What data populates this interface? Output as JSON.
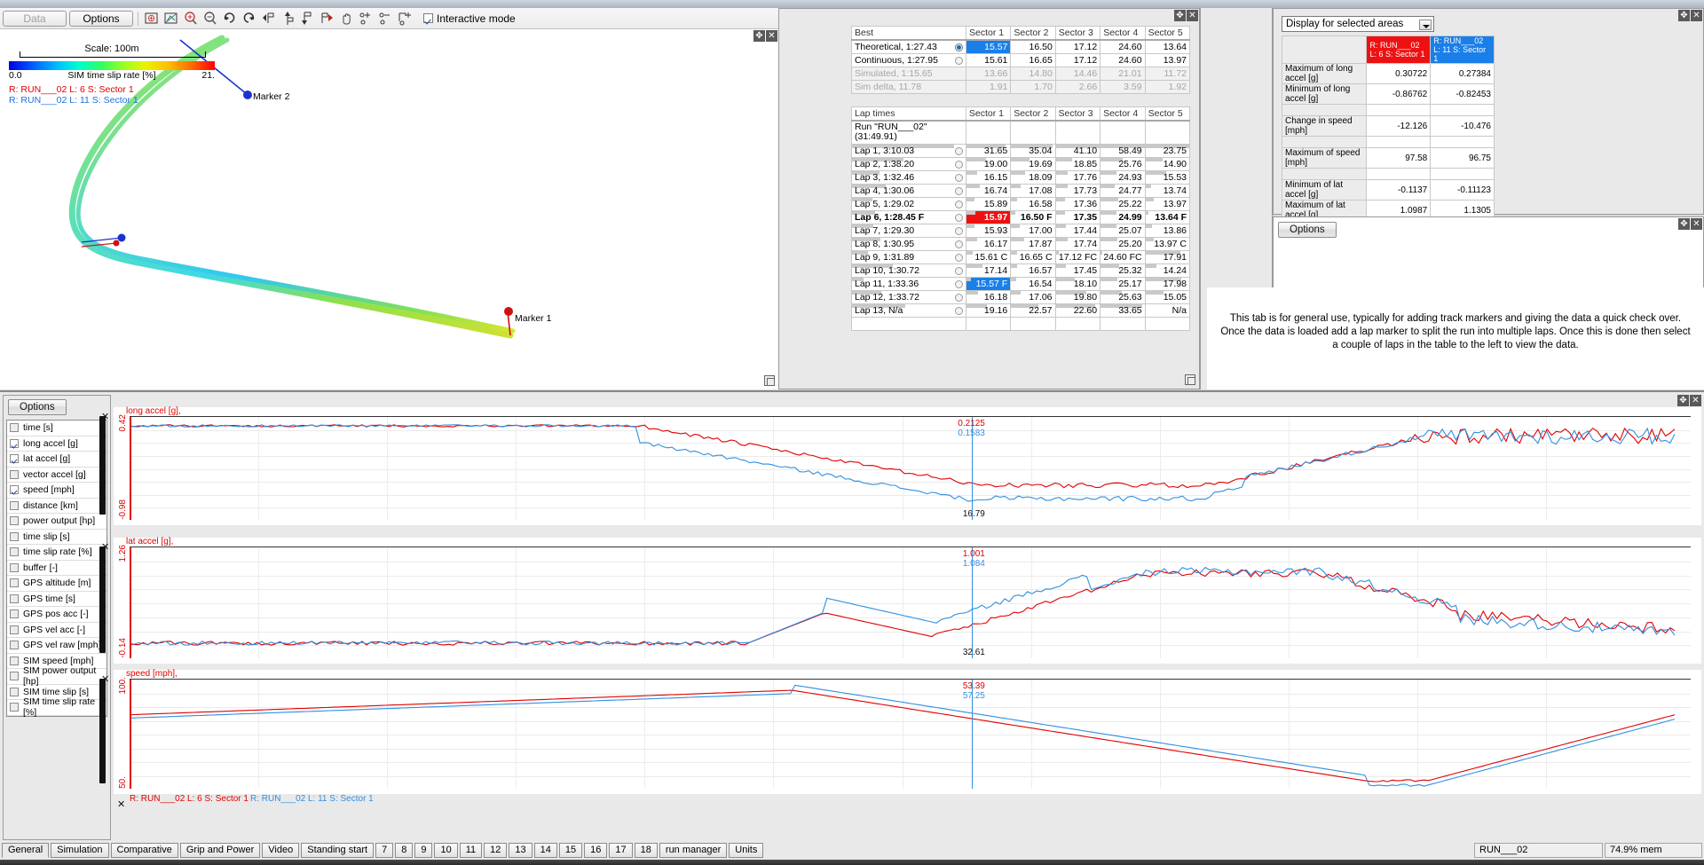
{
  "toolbar": {
    "data_label": "Data",
    "options_label": "Options",
    "interactive_label": "Interactive mode",
    "interactive_checked": true,
    "icons": [
      "zoom-box-icon",
      "fit-view-icon",
      "zoom-in-icon",
      "zoom-out-icon",
      "rotate-cw-icon",
      "rotate-ccw-icon",
      "prev-marker-icon",
      "add-marker-icon",
      "marker-down-icon",
      "next-marker-icon",
      "pan-hand-icon",
      "add-node-icon",
      "remove-node-icon",
      "add-region-icon"
    ]
  },
  "map": {
    "scale_label": "Scale: 100m",
    "colorbar_min": "0.0",
    "colorbar_label": "SIM time slip rate [%]",
    "colorbar_max": "21.",
    "run_red": "R: RUN___02  L: 6  S: Sector 1",
    "run_blue": "R: RUN___02  L: 11  S: Sector 1",
    "marker1": "Marker 1",
    "marker2": "Marker 2"
  },
  "best": {
    "title": "Best",
    "columns": [
      "Sector 1",
      "Sector 2",
      "Sector 3",
      "Sector 4",
      "Sector 5"
    ],
    "rows": [
      {
        "label": "Theoretical,  1:27.43",
        "radio": "on",
        "dim": false,
        "values": [
          "15.57",
          "16.50",
          "17.12",
          "24.60",
          "13.64"
        ],
        "highlight": [
          0
        ]
      },
      {
        "label": "Continuous,  1:27.95",
        "radio": "off",
        "dim": false,
        "values": [
          "15.61",
          "16.65",
          "17.12",
          "24.60",
          "13.97"
        ],
        "highlight": []
      },
      {
        "label": "Simulated, 1:15.65",
        "radio": "none",
        "dim": true,
        "values": [
          "13.66",
          "14.80",
          "14.46",
          "21.01",
          "11.72"
        ],
        "highlight": []
      },
      {
        "label": "Sim delta, 11.78",
        "radio": "none",
        "dim": true,
        "values": [
          "1.91",
          "1.70",
          "2.66",
          "3.59",
          "1.92"
        ],
        "highlight": []
      }
    ]
  },
  "laps": {
    "title": "Lap times",
    "columns": [
      "Sector 1",
      "Sector 2",
      "Sector 3",
      "Sector 4",
      "Sector 5"
    ],
    "run_header": "Run \"RUN___02\"",
    "run_total": "(31:49.91)",
    "rows": [
      {
        "label": "Lap 1, 3:10.03",
        "bold": false,
        "values": [
          "31.65",
          "35.04",
          "41.10",
          "58.49",
          "23.75"
        ],
        "bars": [
          90,
          95,
          100,
          100,
          100
        ],
        "red": [],
        "blue": []
      },
      {
        "label": "Lap 2, 1:38.20",
        "bold": false,
        "values": [
          "19.00",
          "19.69",
          "18.85",
          "25.76",
          "14.90"
        ],
        "bars": [
          45,
          42,
          38,
          50,
          40
        ],
        "red": [],
        "blue": []
      },
      {
        "label": "Lap 3, 1:32.46",
        "bold": false,
        "values": [
          "16.15",
          "18.09",
          "17.76",
          "24.93",
          "15.53"
        ],
        "bars": [
          24,
          32,
          28,
          36,
          48
        ],
        "red": [],
        "blue": []
      },
      {
        "label": "Lap 4, 1:30.06",
        "bold": false,
        "values": [
          "16.74",
          "17.08",
          "17.73",
          "24.77",
          "13.74"
        ],
        "bars": [
          30,
          22,
          27,
          32,
          12
        ],
        "red": [],
        "blue": []
      },
      {
        "label": "Lap 5, 1:29.02",
        "bold": false,
        "values": [
          "15.89",
          "16.58",
          "17.36",
          "25.22",
          "13.97"
        ],
        "bars": [
          18,
          13,
          22,
          40,
          18
        ],
        "red": [],
        "blue": []
      },
      {
        "label": "Lap 6, 1:28.45 F",
        "bold": true,
        "values": [
          "15.97",
          "16.50 F",
          "17.35",
          "24.99",
          "13.64 F"
        ],
        "bars": [
          20,
          10,
          22,
          36,
          6
        ],
        "red": [
          0
        ],
        "blue": []
      },
      {
        "label": "Lap 7, 1:29.30",
        "bold": false,
        "values": [
          "15.93",
          "17.00",
          "17.44",
          "25.07",
          "13.86"
        ],
        "bars": [
          19,
          20,
          23,
          37,
          14
        ],
        "red": [],
        "blue": []
      },
      {
        "label": "Lap 8, 1:30.95",
        "bold": false,
        "values": [
          "16.17",
          "17.87",
          "17.74",
          "25.20",
          "13.97 C"
        ],
        "bars": [
          25,
          30,
          27,
          39,
          18
        ],
        "red": [],
        "blue": []
      },
      {
        "label": "Lap 9, 1:31.89",
        "bold": false,
        "values": [
          "15.61 C",
          "16.65 C",
          "17.12 FC",
          "24.60 FC",
          "17.91"
        ],
        "bars": [
          14,
          14,
          8,
          4,
          80
        ],
        "red": [],
        "blue": []
      },
      {
        "label": "Lap 10, 1:30.72",
        "bold": false,
        "values": [
          "17.14",
          "16.57",
          "17.45",
          "25.32",
          "14.24"
        ],
        "bars": [
          36,
          13,
          23,
          42,
          26
        ],
        "red": [],
        "blue": []
      },
      {
        "label": "Lap 11, 1:33.36",
        "bold": false,
        "values": [
          "15.57 F",
          "16.54",
          "18.10",
          "25.17",
          "17.98"
        ],
        "bars": [
          10,
          12,
          44,
          38,
          82
        ],
        "red": [],
        "blue": [
          0
        ]
      },
      {
        "label": "Lap 12, 1:33.72",
        "bold": false,
        "values": [
          "16.18",
          "17.06",
          "19.80",
          "25.63",
          "15.05"
        ],
        "bars": [
          26,
          21,
          70,
          48,
          42
        ],
        "red": [],
        "blue": []
      },
      {
        "label": "Lap 13, N/a",
        "bold": false,
        "values": [
          "19.16",
          "22.57",
          "22.60",
          "33.65",
          "N/a"
        ],
        "bars": [
          47,
          62,
          90,
          95,
          0
        ],
        "red": [],
        "blue": []
      }
    ]
  },
  "rightpanel": {
    "dropdown_value": "Display for selected areas",
    "col_red": "R: RUN___02  L: 6 S: Sector 1",
    "col_blue": "R: RUN___02  L: 11 S: Sector 1",
    "stats": [
      {
        "label": "Maximum of long accel [g]",
        "red": "0.30722",
        "blue": "0.27384"
      },
      {
        "label": "Minimum of long accel [g]",
        "red": "-0.86762",
        "blue": "-0.82453"
      },
      {
        "label": "",
        "red": "",
        "blue": ""
      },
      {
        "label": "Change in speed [mph]",
        "red": "-12.126",
        "blue": "-10.476"
      },
      {
        "label": "",
        "red": "",
        "blue": ""
      },
      {
        "label": "Maximum of speed [mph]",
        "red": "97.58",
        "blue": "96.75"
      },
      {
        "label": "",
        "red": "",
        "blue": ""
      },
      {
        "label": "Minimum of lat accel [g]",
        "red": "-0.1137",
        "blue": "-0.11123"
      },
      {
        "label": "Maximum of lat accel [g]",
        "red": "1.0987",
        "blue": "1.1305"
      },
      {
        "label": "",
        "red": "",
        "blue": ""
      },
      {
        "label": "",
        "red": "",
        "blue": ""
      },
      {
        "label": "",
        "red": "",
        "blue": ""
      }
    ],
    "options_label": "Options",
    "info_text": "This tab is for general use, typically for adding track markers and giving the data a quick check over. Once the data is loaded add a lap marker to split the run into multiple laps. Once this is done then select a couple of laps in the table to the left to view the data."
  },
  "channels": {
    "options_label": "Options",
    "items": [
      {
        "label": "time [s]",
        "checked": false
      },
      {
        "label": "long accel [g]",
        "checked": true
      },
      {
        "label": "lat accel [g]",
        "checked": true
      },
      {
        "label": "vector accel [g]",
        "checked": false
      },
      {
        "label": "speed [mph]",
        "checked": true
      },
      {
        "label": "distance [km]",
        "checked": false
      },
      {
        "label": "power output [hp]",
        "checked": false
      },
      {
        "label": "time slip [s]",
        "checked": false
      },
      {
        "label": "time slip rate [%]",
        "checked": false
      },
      {
        "label": "buffer [-]",
        "checked": false
      },
      {
        "label": "GPS altitude [m]",
        "checked": false
      },
      {
        "label": "GPS time [s]",
        "checked": false
      },
      {
        "label": "GPS pos acc [-]",
        "checked": false
      },
      {
        "label": "GPS vel acc [-]",
        "checked": false
      },
      {
        "label": "GPS vel raw [mph]",
        "checked": false
      },
      {
        "label": "SIM speed [mph]",
        "checked": false
      },
      {
        "label": "SIM power output [hp]",
        "checked": false
      },
      {
        "label": "SIM time slip [s]",
        "checked": false
      },
      {
        "label": "SIM time slip rate [%]",
        "checked": false
      }
    ]
  },
  "chart_data": [
    {
      "type": "line",
      "title": "long accel [g],",
      "ylabel": "long accel [g]",
      "ylim": [
        -0.98,
        0.42
      ],
      "ytop_label": "0.42",
      "ybot_label": "-0.98",
      "cursor_readouts": {
        "red": "0.2125",
        "blue": "0.1583",
        "black": "16.79"
      },
      "series": [
        {
          "name": "R: RUN___02 L: 6 S: Sector 1",
          "color": "#e00000"
        },
        {
          "name": "R: RUN___02 L: 11 S: Sector 1",
          "color": "#2f8fe0"
        }
      ]
    },
    {
      "type": "line",
      "title": "lat accel [g],",
      "ylabel": "lat accel [g]",
      "ylim": [
        -0.14,
        1.26
      ],
      "ytop_label": "1.26",
      "ybot_label": "-0.14",
      "cursor_readouts": {
        "red": "1.001",
        "blue": "1.084",
        "black": "32.61"
      },
      "series": [
        {
          "name": "R: RUN___02 L: 6 S: Sector 1",
          "color": "#e00000"
        },
        {
          "name": "R: RUN___02 L: 11 S: Sector 1",
          "color": "#2f8fe0"
        }
      ]
    },
    {
      "type": "line",
      "title": "speed [mph],",
      "ylabel": "speed [mph]",
      "ylim": [
        50,
        100
      ],
      "ytop_label": "100.",
      "ybot_label": "50.",
      "cursor_readouts": {
        "red": "53.39",
        "blue": "57.25",
        "black": ""
      },
      "series": [
        {
          "name": "R: RUN___02 L: 6 S: Sector 1",
          "color": "#e00000"
        },
        {
          "name": "R: RUN___02 L: 11 S: Sector 1",
          "color": "#2f8fe0"
        }
      ]
    }
  ],
  "chart_legend": {
    "red": "R: RUN___02  L: 6  S: Sector 1",
    "blue": "R: RUN___02  L: 11  S: Sector 1"
  },
  "tabs": [
    {
      "label": "General",
      "active": true
    },
    {
      "label": "Simulation",
      "active": false
    },
    {
      "label": "Comparative",
      "active": false
    },
    {
      "label": "Grip and Power",
      "active": false
    },
    {
      "label": "Video",
      "active": false
    },
    {
      "label": "Standing start",
      "active": false
    },
    {
      "label": "7",
      "active": false
    },
    {
      "label": "8",
      "active": false
    },
    {
      "label": "9",
      "active": false
    },
    {
      "label": "10",
      "active": false
    },
    {
      "label": "11",
      "active": false
    },
    {
      "label": "12",
      "active": false
    },
    {
      "label": "13",
      "active": false
    },
    {
      "label": "14",
      "active": false
    },
    {
      "label": "15",
      "active": false
    },
    {
      "label": "16",
      "active": false
    },
    {
      "label": "17",
      "active": false
    },
    {
      "label": "18",
      "active": false
    },
    {
      "label": "run manager",
      "active": false
    },
    {
      "label": "Units",
      "active": false
    }
  ],
  "status": {
    "run_name": "RUN___02",
    "memory": "74.9% mem"
  },
  "colors": {
    "red": "#e00000",
    "blue": "#2f8fe0",
    "select_blue": "#1a7fe8",
    "select_red": "#ee1111"
  }
}
